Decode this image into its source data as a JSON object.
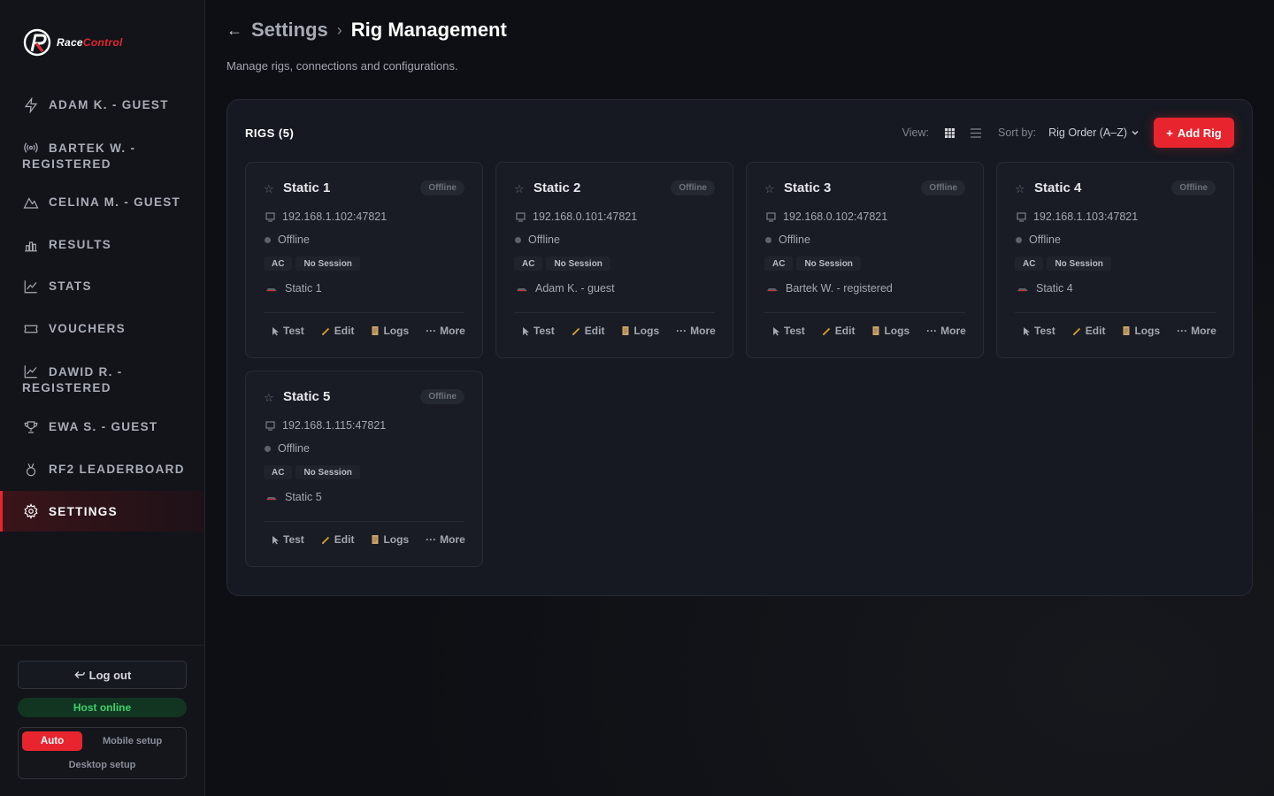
{
  "app": {
    "logo_word1": "Race",
    "logo_word2": "Control"
  },
  "nav": [
    {
      "label": "ADAM K. - GUEST",
      "icon": "bolt-icon"
    },
    {
      "label1": "BARTEK W. -",
      "label2": "REGISTERED",
      "icon": "broadcast-icon"
    },
    {
      "label": "CELINA M. - GUEST",
      "icon": "mountain-icon"
    },
    {
      "label": "RESULTS",
      "icon": "bar-chart-icon"
    },
    {
      "label": "STATS",
      "icon": "line-chart-icon"
    },
    {
      "label": "VOUCHERS",
      "icon": "ticket-icon"
    },
    {
      "label1": "DAWID R. -",
      "label2": "REGISTERED",
      "icon": "line-chart-icon"
    },
    {
      "label": "EWA S. - GUEST",
      "icon": "trophy-icon"
    },
    {
      "label": "RF2 LEADERBOARD",
      "icon": "medal-icon"
    },
    {
      "label": "SETTINGS",
      "icon": "gear-icon",
      "active": true
    }
  ],
  "sidebar_bottom": {
    "logout_label": "Log out",
    "host_status": "Host online",
    "mode_auto": "Auto",
    "mode_mobile": "Mobile setup",
    "mode_desktop": "Desktop setup"
  },
  "header": {
    "back": "←",
    "crumb_parent": "Settings",
    "separator": "›",
    "crumb_current": "Rig Management",
    "subtitle": "Manage rigs, connections and configurations."
  },
  "panel": {
    "title": "RIGS (5)",
    "view_label": "View:",
    "sort_label": "Sort by:",
    "sort_value": "Rig Order (A–Z)",
    "add_label": "Add Rig",
    "add_plus": "+"
  },
  "rigs": [
    {
      "name": "Static 1",
      "badge": "Offline",
      "ip": "192.168.1.102:47821",
      "status": "Offline",
      "tag1": "AC",
      "tag2": "No Session",
      "driver": "Static 1"
    },
    {
      "name": "Static 2",
      "badge": "Offline",
      "ip": "192.168.0.101:47821",
      "status": "Offline",
      "tag1": "AC",
      "tag2": "No Session",
      "driver": "Adam K. - guest"
    },
    {
      "name": "Static 3",
      "badge": "Offline",
      "ip": "192.168.0.102:47821",
      "status": "Offline",
      "tag1": "AC",
      "tag2": "No Session",
      "driver": "Bartek W. - registered"
    },
    {
      "name": "Static 4",
      "badge": "Offline",
      "ip": "192.168.1.103:47821",
      "status": "Offline",
      "tag1": "AC",
      "tag2": "No Session",
      "driver": "Static 4"
    },
    {
      "name": "Static 5",
      "badge": "Offline",
      "ip": "192.168.1.115:47821",
      "status": "Offline",
      "tag1": "AC",
      "tag2": "No Session",
      "driver": "Static 5"
    }
  ],
  "card_actions": {
    "test": "Test",
    "edit": "Edit",
    "logs": "Logs",
    "more": "More"
  },
  "colors": {
    "accent": "#e8252f",
    "online": "#3bd36b"
  }
}
